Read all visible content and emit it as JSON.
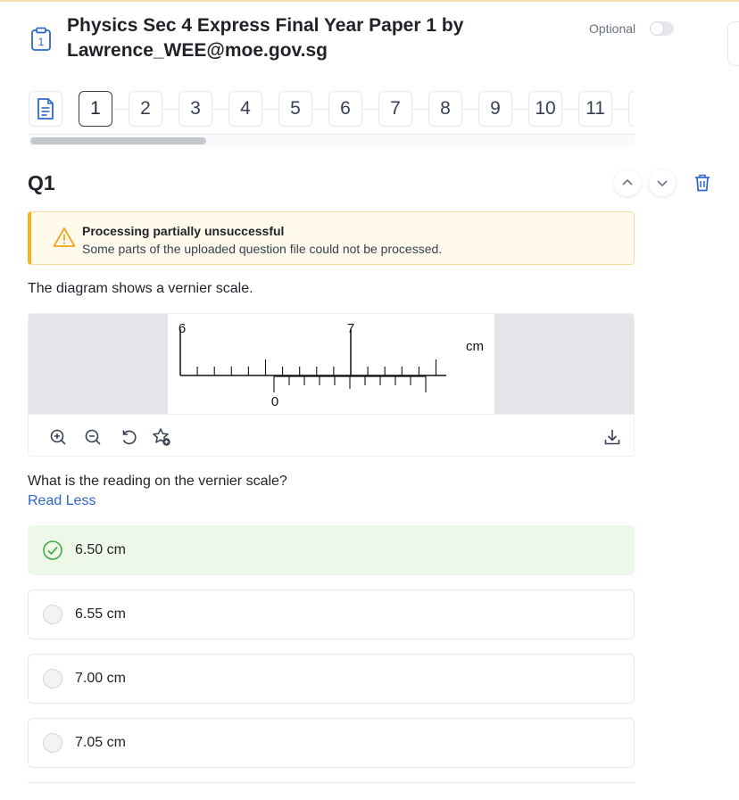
{
  "header": {
    "title": "Physics Sec 4 Express Final Year Paper 1 by Lawrence_WEE@moe.gov.sg",
    "optional_label": "Optional",
    "doc_icon": "clipboard-number-icon",
    "doc_icon_number": "1"
  },
  "question_nav": {
    "doc_icon": "document-icon",
    "items": [
      "1",
      "2",
      "3",
      "4",
      "5",
      "6",
      "7",
      "8",
      "9",
      "10",
      "11"
    ],
    "active": "1"
  },
  "question": {
    "label": "Q1",
    "warning": {
      "title": "Processing partially unsuccessful",
      "text": "Some parts of the uploaded question file could not be processed."
    },
    "stem_part1": "The diagram shows a vernier scale.",
    "stem_part2": "What is the reading on the vernier scale?",
    "read_less": "Read Less",
    "diagram": {
      "main_label_left": "6",
      "main_label_right": "7",
      "unit": "cm",
      "vernier_zero": "0"
    },
    "options": [
      {
        "text": "6.50 cm",
        "correct": true
      },
      {
        "text": "6.55 cm",
        "correct": false
      },
      {
        "text": "7.00 cm",
        "correct": false
      },
      {
        "text": "7.05 cm",
        "correct": false
      }
    ]
  },
  "colors": {
    "accent": "#2f67c9",
    "warning_border": "#f5b31b",
    "correct_bg": "#eef8e9",
    "correct_check": "#3aa53a"
  }
}
